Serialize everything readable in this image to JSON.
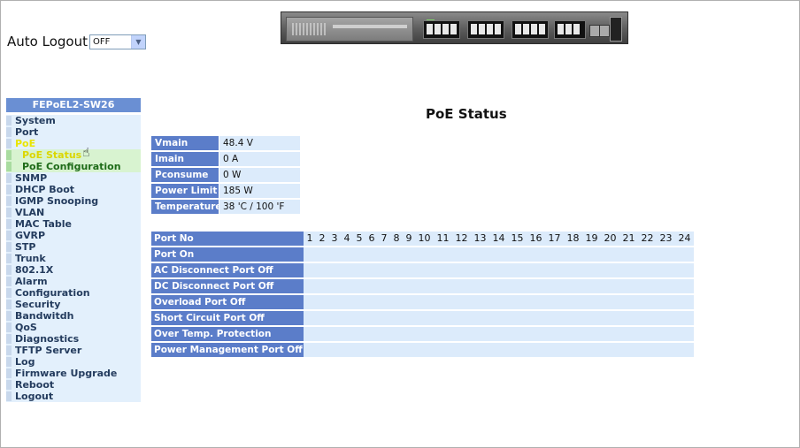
{
  "auto_logout": {
    "label": "Auto Logout",
    "value": "OFF"
  },
  "sidebar": {
    "title": "FEPoEL2-SW26",
    "items": [
      {
        "label": "System"
      },
      {
        "label": "Port"
      },
      {
        "label": "PoE"
      },
      {
        "label": "PoE Status"
      },
      {
        "label": "PoE Configuration"
      },
      {
        "label": "SNMP"
      },
      {
        "label": "DHCP Boot"
      },
      {
        "label": "IGMP Snooping"
      },
      {
        "label": "VLAN"
      },
      {
        "label": "MAC Table"
      },
      {
        "label": "GVRP"
      },
      {
        "label": "STP"
      },
      {
        "label": "Trunk"
      },
      {
        "label": "802.1X"
      },
      {
        "label": "Alarm"
      },
      {
        "label": "Configuration"
      },
      {
        "label": "Security"
      },
      {
        "label": "Bandwitdh"
      },
      {
        "label": "QoS"
      },
      {
        "label": "Diagnostics"
      },
      {
        "label": "TFTP Server"
      },
      {
        "label": "Log"
      },
      {
        "label": "Firmware Upgrade"
      },
      {
        "label": "Reboot"
      },
      {
        "label": "Logout"
      }
    ]
  },
  "page_title": "PoE Status",
  "status": [
    {
      "label": "Vmain",
      "value": "48.4 V"
    },
    {
      "label": "Imain",
      "value": "0 A"
    },
    {
      "label": "Pconsume",
      "value": "0 W"
    },
    {
      "label": "Power Limit",
      "value": "185 W"
    },
    {
      "label": "Temperature",
      "value": "38 'C / 100 'F"
    }
  ],
  "ports": {
    "header": "Port No",
    "numbers": [
      "1",
      "2",
      "3",
      "4",
      "5",
      "6",
      "7",
      "8",
      "9",
      "10",
      "11",
      "12",
      "13",
      "14",
      "15",
      "16",
      "17",
      "18",
      "19",
      "20",
      "21",
      "22",
      "23",
      "24"
    ],
    "rows": [
      "Port On",
      "AC Disconnect Port Off",
      "DC Disconnect Port Off",
      "Overload Port Off",
      "Short Circuit Port Off",
      "Over Temp. Protection",
      "Power Management Port Off"
    ]
  },
  "colors": {
    "label_bg": "#5b7dc9",
    "cell_bg": "#dcebfb",
    "sidebar_bg": "#e3f0fc",
    "active_text": "#e9e500"
  }
}
